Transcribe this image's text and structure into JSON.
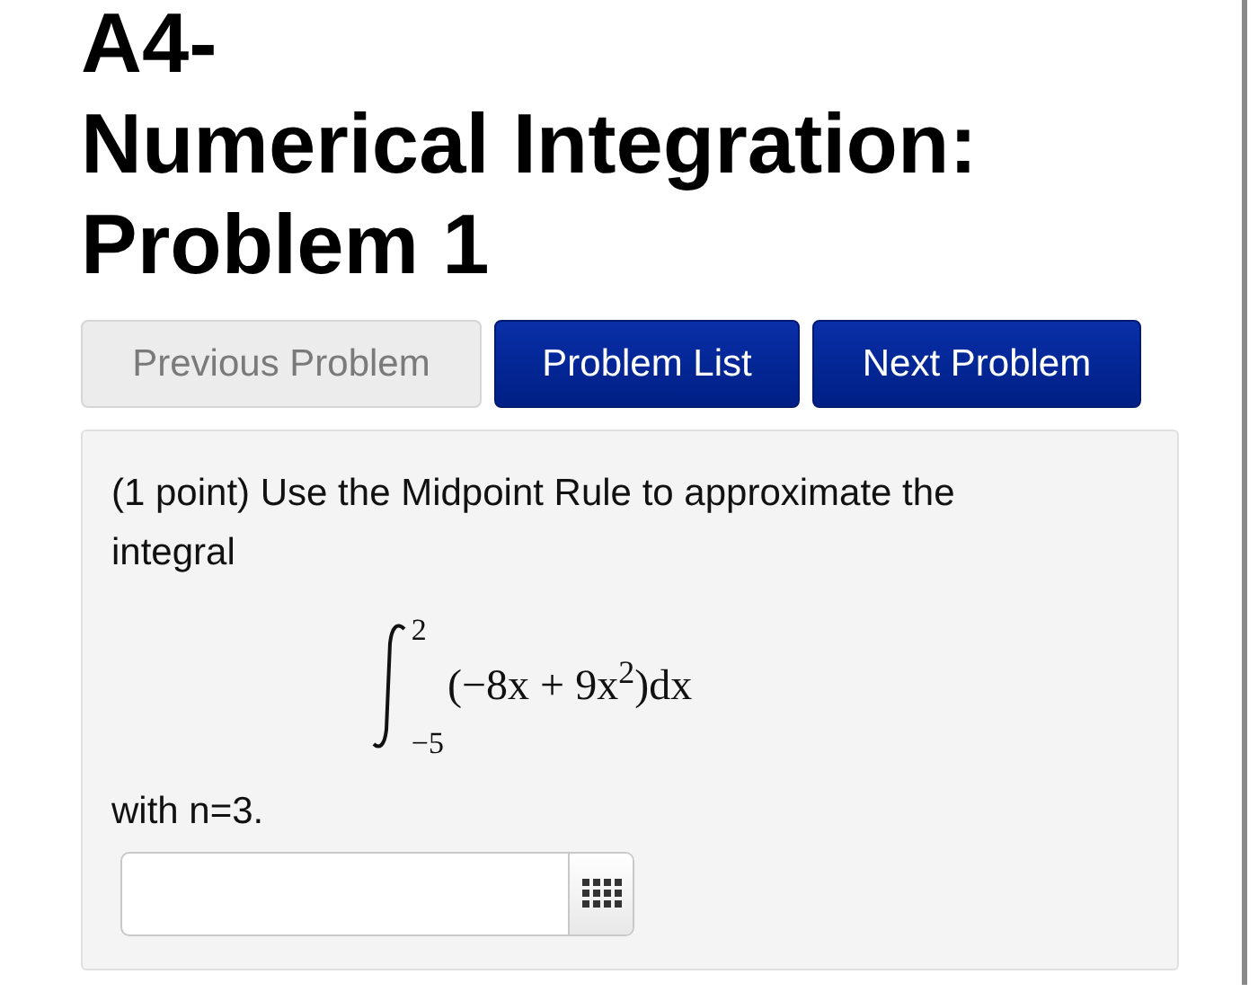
{
  "title_lines": [
    "A4-",
    "Numerical Integration:",
    "Problem 1"
  ],
  "nav_buttons": [
    {
      "label": "Previous Problem",
      "disabled": true
    },
    {
      "label": "Problem List",
      "disabled": false
    },
    {
      "label": "Next Problem",
      "disabled": false
    }
  ],
  "problem": {
    "prompt": "(1 point) Use the Midpoint Rule to approximate the integral",
    "integral": {
      "upper": "2",
      "lower": "−5",
      "integrand": "(−8x + 9x$^{2}$)dx"
    },
    "condition": "with n=3."
  }
}
